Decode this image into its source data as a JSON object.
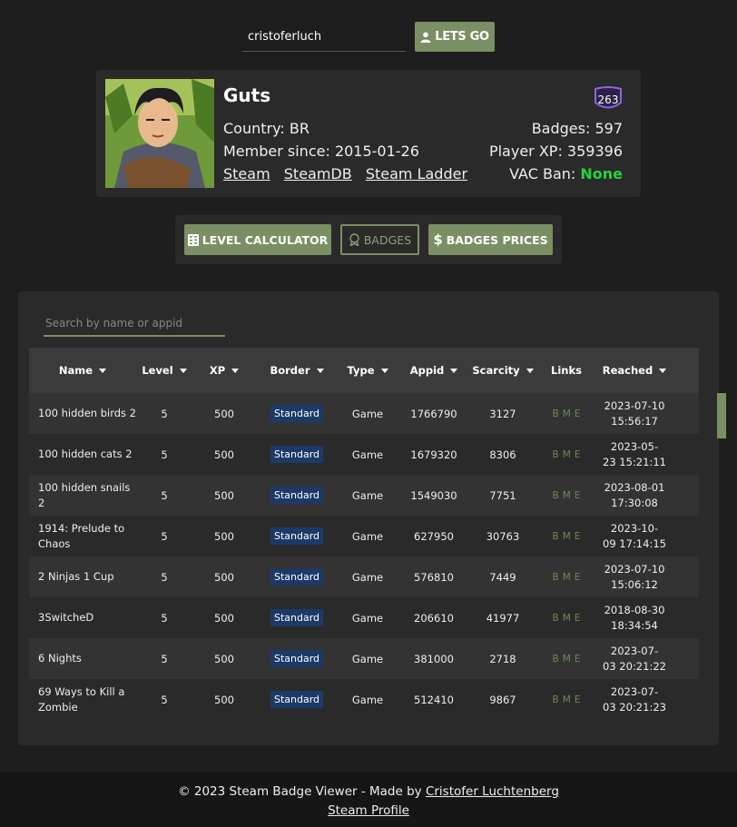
{
  "search": {
    "username": "cristoferluch",
    "go_label": "LETS GO"
  },
  "profile": {
    "name": "Guts",
    "level": "263",
    "country": "Country: BR",
    "member_since": "Member since: 2015-01-26",
    "links": [
      "Steam",
      "SteamDB",
      "Steam Ladder"
    ],
    "badges": "Badges: 597",
    "player_xp": "Player XP: 359396",
    "vac_label": "VAC Ban: ",
    "vac_value": "None"
  },
  "tools": {
    "level_calculator": "LEVEL CALCULATOR",
    "badges": "BADGES",
    "badges_prices": "BADGES PRICES"
  },
  "table": {
    "search_placeholder": "Search by name or appid",
    "columns": [
      "Name",
      "Level",
      "XP",
      "Border",
      "Type",
      "Appid",
      "Scarcity",
      "Links",
      "Reached"
    ],
    "rows": [
      {
        "name": "100 hidden birds 2",
        "level": "5",
        "xp": "500",
        "border": "Standard",
        "type": "Game",
        "appid": "1766790",
        "scarcity": "3127",
        "links": [
          "B",
          "M",
          "E"
        ],
        "reached_1": "2023-07-10",
        "reached_2": "15:56:17"
      },
      {
        "name": "100 hidden cats 2",
        "level": "5",
        "xp": "500",
        "border": "Standard",
        "type": "Game",
        "appid": "1679320",
        "scarcity": "8306",
        "links": [
          "B",
          "M",
          "E"
        ],
        "reached_1": "2023-05-",
        "reached_2": "23 15:21:11"
      },
      {
        "name": "100 hidden snails 2",
        "level": "5",
        "xp": "500",
        "border": "Standard",
        "type": "Game",
        "appid": "1549030",
        "scarcity": "7751",
        "links": [
          "B",
          "M",
          "E"
        ],
        "reached_1": "2023-08-01",
        "reached_2": "17:30:08"
      },
      {
        "name": "1914: Prelude to Chaos",
        "level": "5",
        "xp": "500",
        "border": "Standard",
        "type": "Game",
        "appid": "627950",
        "scarcity": "30763",
        "links": [
          "B",
          "M",
          "E"
        ],
        "reached_1": "2023-10-",
        "reached_2": "09 17:14:15"
      },
      {
        "name": "2 Ninjas 1 Cup",
        "level": "5",
        "xp": "500",
        "border": "Standard",
        "type": "Game",
        "appid": "576810",
        "scarcity": "7449",
        "links": [
          "B",
          "M",
          "E"
        ],
        "reached_1": "2023-07-10",
        "reached_2": "15:06:12"
      },
      {
        "name": "3SwitcheD",
        "level": "5",
        "xp": "500",
        "border": "Standard",
        "type": "Game",
        "appid": "206610",
        "scarcity": "41977",
        "links": [
          "B",
          "M",
          "E"
        ],
        "reached_1": "2018-08-30",
        "reached_2": "18:34:54"
      },
      {
        "name": "6 Nights",
        "level": "5",
        "xp": "500",
        "border": "Standard",
        "type": "Game",
        "appid": "381000",
        "scarcity": "2718",
        "links": [
          "B",
          "M",
          "E"
        ],
        "reached_1": "2023-07-",
        "reached_2": "03 20:21:22"
      },
      {
        "name": "69 Ways to Kill a Zombie",
        "level": "5",
        "xp": "500",
        "border": "Standard",
        "type": "Game",
        "appid": "512410",
        "scarcity": "9867",
        "links": [
          "B",
          "M",
          "E"
        ],
        "reached_1": "2023-07-",
        "reached_2": "03 20:21:23"
      }
    ]
  },
  "footer": {
    "text": "© 2023 Steam Badge Viewer - Made by ",
    "author": "Cristofer Luchtenberg",
    "profile_link": "Steam Profile"
  },
  "colors": {
    "accent": "#7a8f63",
    "badge_blue": "#1c3a68",
    "vac_green": "#27d33a",
    "level_purple": "#7a50c8"
  }
}
